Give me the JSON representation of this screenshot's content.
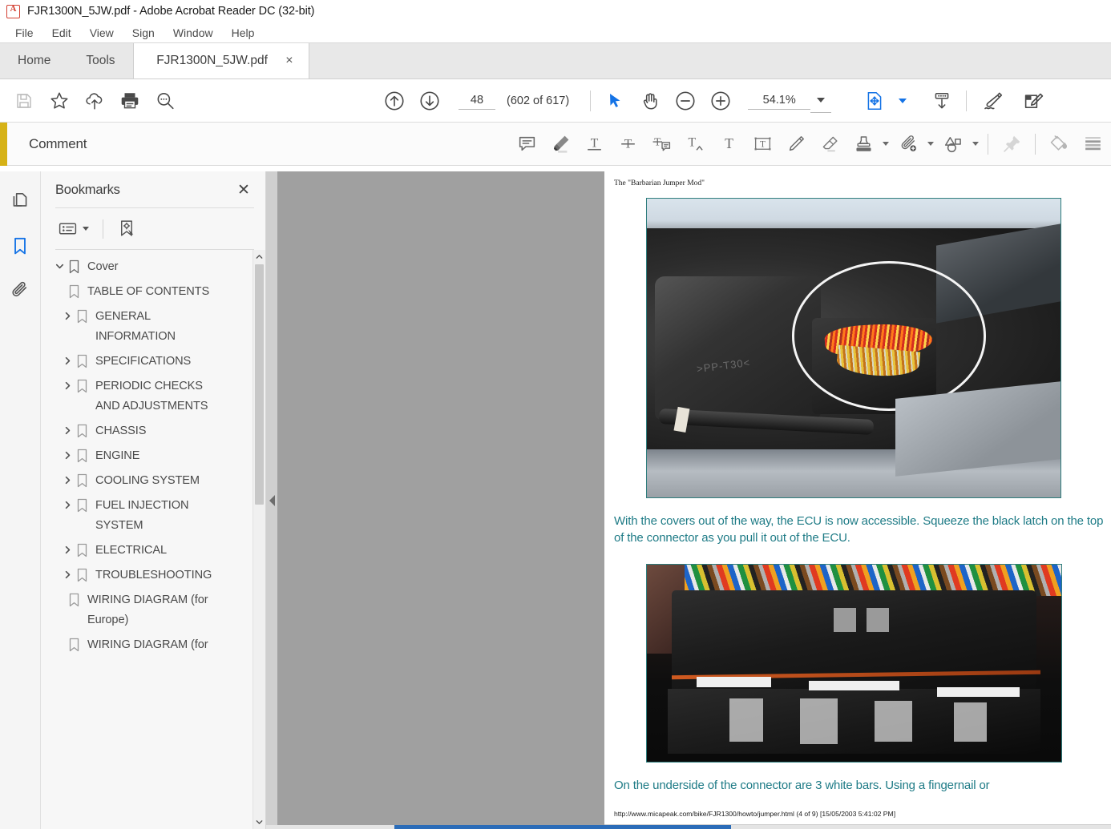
{
  "window": {
    "title": "FJR1300N_5JW.pdf - Adobe Acrobat Reader DC (32-bit)",
    "app_icon": "pdf-logo-icon"
  },
  "menubar": {
    "items": [
      {
        "label": "File"
      },
      {
        "label": "Edit"
      },
      {
        "label": "View"
      },
      {
        "label": "Sign"
      },
      {
        "label": "Window"
      },
      {
        "label": "Help"
      }
    ]
  },
  "tabs": {
    "home": "Home",
    "tools": "Tools",
    "document": "FJR1300N_5JW.pdf",
    "close_glyph": "×"
  },
  "toolbar": {
    "left_tools": [
      {
        "name": "save-icon",
        "title": "Save",
        "disabled": true
      },
      {
        "name": "star-icon",
        "title": "Add to favourites",
        "disabled": false
      },
      {
        "name": "cloud-upload-icon",
        "title": "Save to cloud",
        "disabled": false
      },
      {
        "name": "print-icon",
        "title": "Print",
        "disabled": false
      },
      {
        "name": "search-icon",
        "title": "Find",
        "disabled": false
      }
    ],
    "page_up_icon": "arrow-up-circle-icon",
    "page_down_icon": "arrow-down-circle-icon",
    "page_number": "48",
    "page_count_label": "(602 of 617)",
    "select_icon": "cursor-select-icon",
    "hand_icon": "hand-pan-icon",
    "zoom_out_icon": "zoom-out-icon",
    "zoom_in_icon": "zoom-in-icon",
    "zoom_level": "54.1%",
    "fit_page_icon": "fit-page-icon",
    "download_pages_icon": "page-download-icon",
    "sign_icon": "sign-pdf-icon",
    "edit_icon": "edit-pdf-icon"
  },
  "comment_bar": {
    "title": "Comment",
    "accent_color": "#d6b217",
    "tools": [
      {
        "name": "sticky-note-icon",
        "title": "Add sticky note"
      },
      {
        "name": "highlight-text-icon",
        "title": "Highlight text"
      },
      {
        "name": "underline-text-icon",
        "title": "Underline text"
      },
      {
        "name": "strikethrough-text-icon",
        "title": "Strikethrough text"
      },
      {
        "name": "replace-text-icon",
        "title": "Add note to replace text"
      },
      {
        "name": "insert-text-icon",
        "title": "Insert text at cursor"
      },
      {
        "name": "add-text-comment-icon",
        "title": "Add text comment"
      },
      {
        "name": "text-box-icon",
        "title": "Add text box"
      },
      {
        "name": "draw-free-icon",
        "title": "Draw free form"
      },
      {
        "name": "erase-icon",
        "title": "Erase free form"
      },
      {
        "name": "stamp-icon",
        "title": "Add stamp",
        "has_caret": true
      },
      {
        "name": "attach-file-icon",
        "title": "Add attachment",
        "has_caret": true
      },
      {
        "name": "shapes-icon",
        "title": "Drawing tools",
        "has_caret": true
      },
      {
        "name": "pin-icon",
        "title": "Keep tool selected",
        "disabled": true
      },
      {
        "name": "fill-color-icon",
        "title": "Colour"
      },
      {
        "name": "properties-list-icon",
        "title": "Comment list"
      }
    ]
  },
  "rail": {
    "items": [
      {
        "name": "page-thumbnails-icon",
        "label": "Page Thumbnails",
        "active": false
      },
      {
        "name": "bookmarks-icon",
        "label": "Bookmarks",
        "active": true
      },
      {
        "name": "attachments-icon",
        "label": "Attachments",
        "active": false
      }
    ]
  },
  "bookmarks_panel": {
    "title": "Bookmarks",
    "close_glyph": "✕",
    "options_icon": "bookmark-options-icon",
    "new_bookmark_icon": "new-bookmark-icon",
    "items": [
      {
        "label": "Cover",
        "level": 0,
        "arrow": "down",
        "expanded": true
      },
      {
        "label": "TABLE OF CONTENTS",
        "level": 1,
        "arrow": "none"
      },
      {
        "label": "GENERAL INFORMATION",
        "level": 1,
        "arrow": "right"
      },
      {
        "label": "SPECIFICATIONS",
        "level": 1,
        "arrow": "right"
      },
      {
        "label": "PERIODIC CHECKS AND ADJUSTMENTS",
        "level": 1,
        "arrow": "right"
      },
      {
        "label": "CHASSIS",
        "level": 1,
        "arrow": "right"
      },
      {
        "label": "ENGINE",
        "level": 1,
        "arrow": "right"
      },
      {
        "label": "COOLING SYSTEM",
        "level": 1,
        "arrow": "right"
      },
      {
        "label": "FUEL INJECTION SYSTEM",
        "level": 1,
        "arrow": "right"
      },
      {
        "label": "ELECTRICAL",
        "level": 1,
        "arrow": "right"
      },
      {
        "label": "TROUBLESHOOTING",
        "level": 1,
        "arrow": "right"
      },
      {
        "label": "WIRING DIAGRAM (for Europe)",
        "level": 1,
        "arrow": "none"
      },
      {
        "label": "WIRING DIAGRAM (for",
        "level": 1,
        "arrow": "none"
      }
    ]
  },
  "document": {
    "heading": "The \"Barbarian Jumper Mod\"",
    "figure_1_alt": "Photograph of motorcycle ECU area with white ellipse highlighting the wiring connector",
    "caption_1": "With the covers out of the way, the ECU is now accessible. Squeeze the black latch on the top of the connector as you pull it out of the ECU.",
    "figure_2_alt": "Close-up photograph of the underside of the ECU connector showing three white bars",
    "caption_2": "On the underside of the connector are 3 white bars. Using a fingernail or",
    "footer": "http://www.micapeak.com/bike/FJR1300/howto/jumper.html (4 of 9) [15/05/2003 5:41:02 PM]",
    "caption_color": "#1e7b86"
  }
}
